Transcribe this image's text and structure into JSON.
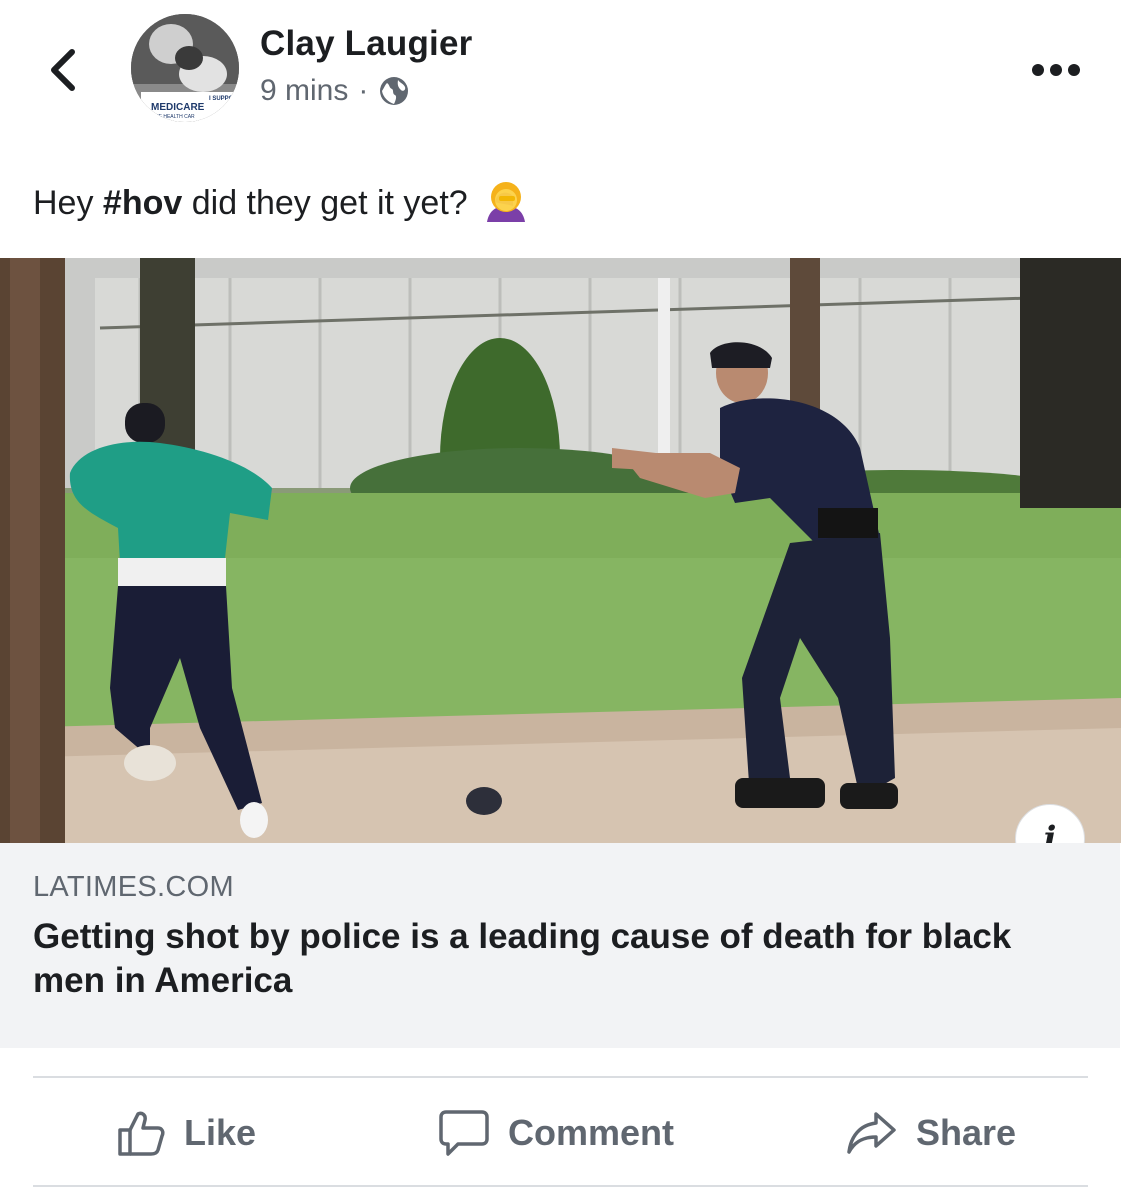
{
  "post": {
    "author": "Clay Laugier",
    "time": "9 mins",
    "separator": "·",
    "privacy_icon": "globe-icon",
    "text_before": "Hey ",
    "hashtag": "#hov",
    "text_after": " did they get it yet?",
    "emoji": "woman-facepalming"
  },
  "avatar": {
    "badge_top": "I SUPPO",
    "badge_main": "MEDICARE",
    "badge_sub": "HE HEALTH CAR"
  },
  "link": {
    "domain": "LATIMES.COM",
    "headline": "Getting shot by police is a leading cause of death for black men in America",
    "info_label": "i"
  },
  "actions": {
    "like": "Like",
    "comment": "Comment",
    "share": "Share"
  },
  "colors": {
    "text": "#1c1e21",
    "secondary": "#606770",
    "link_bg": "#f2f3f5",
    "divider": "#dadde1"
  }
}
